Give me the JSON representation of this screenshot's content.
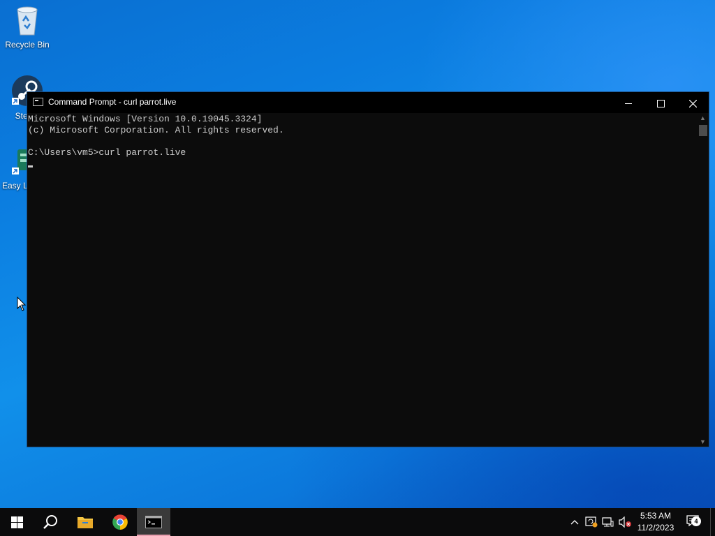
{
  "desktop": {
    "icons": [
      {
        "label": "Recycle Bin",
        "icon": "recycle-bin-icon"
      },
      {
        "label": "Steam",
        "icon": "steam-icon"
      },
      {
        "label": "Easy Launcher",
        "icon": "easy-launcher-icon"
      }
    ]
  },
  "window": {
    "title": "Command Prompt - curl  parrot.live",
    "minimize": "minimize",
    "maximize": "maximize",
    "close": "close",
    "console_lines": [
      "Microsoft Windows [Version 10.0.19045.3324]",
      "(c) Microsoft Corporation. All rights reserved.",
      "",
      "C:\\Users\\vm5>curl parrot.live"
    ]
  },
  "taskbar": {
    "pinned": [
      {
        "name": "start",
        "icon": "windows-logo-icon"
      },
      {
        "name": "search",
        "icon": "search-icon"
      },
      {
        "name": "file-explorer",
        "icon": "folder-icon"
      },
      {
        "name": "chrome",
        "icon": "chrome-icon"
      },
      {
        "name": "command-prompt",
        "icon": "cmd-icon",
        "active": true
      }
    ],
    "clock": {
      "time": "5:53 AM",
      "date": "11/2/2023"
    },
    "notification_count": "4"
  },
  "colors": {
    "console_bg": "#0c0c0c",
    "console_text": "#cccccc",
    "taskbar_bg": "#0b0b0c",
    "active_indicator": "#e8a0b0"
  }
}
